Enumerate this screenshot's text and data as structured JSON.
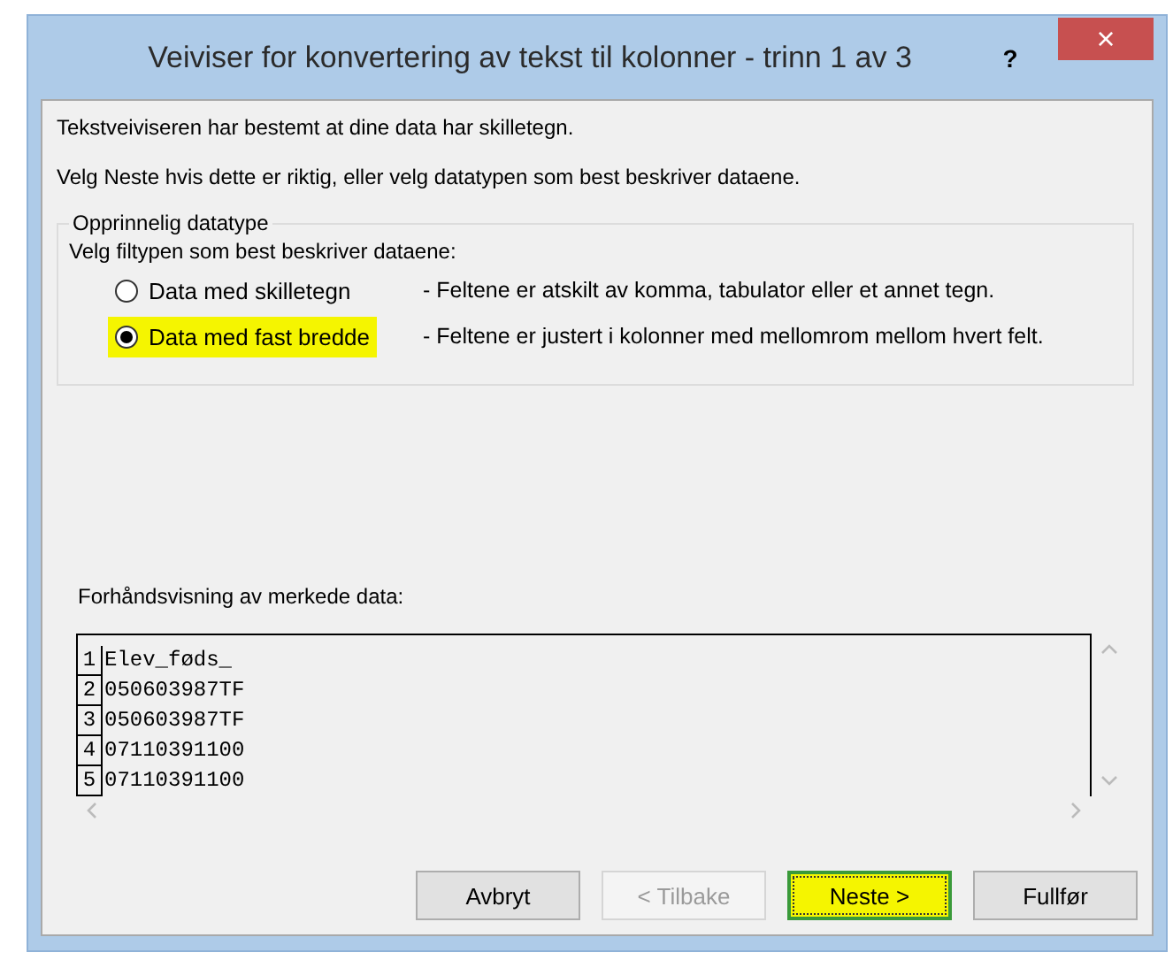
{
  "window": {
    "title": "Veiviser for konvertering av tekst til kolonner - trinn 1 av 3",
    "help": "?",
    "close": "×"
  },
  "intro": [
    "Tekstveiviseren har bestemt at dine data har skilletegn.",
    "Velg Neste hvis dette er riktig, eller velg datatypen som best beskriver dataene."
  ],
  "group": {
    "title": "Opprinnelig datatype",
    "prompt": "Velg filtypen som best beskriver dataene:",
    "options": [
      {
        "label": "Data med skilletegn",
        "description": "- Feltene er atskilt av komma, tabulator eller et annet tegn.",
        "selected": false,
        "highlighted": false
      },
      {
        "label": "Data med fast bredde",
        "description": "- Feltene er justert i kolonner med mellomrom mellom hvert felt.",
        "selected": true,
        "highlighted": true
      }
    ]
  },
  "preview": {
    "label": "Forhåndsvisning av merkede data:",
    "rows": [
      {
        "number": "1",
        "text": "Elev_føds_"
      },
      {
        "number": "2",
        "text": "050603987TF"
      },
      {
        "number": "3",
        "text": "050603987TF"
      },
      {
        "number": "4",
        "text": "07110391100"
      },
      {
        "number": "5",
        "text": "07110391100"
      }
    ]
  },
  "buttons": [
    {
      "label": "Avbryt",
      "disabled": false,
      "highlighted": false
    },
    {
      "label": "< Tilbake",
      "disabled": true,
      "highlighted": false
    },
    {
      "label": "Neste >",
      "disabled": false,
      "highlighted": true
    },
    {
      "label": "Fullfør",
      "disabled": false,
      "highlighted": false
    }
  ]
}
